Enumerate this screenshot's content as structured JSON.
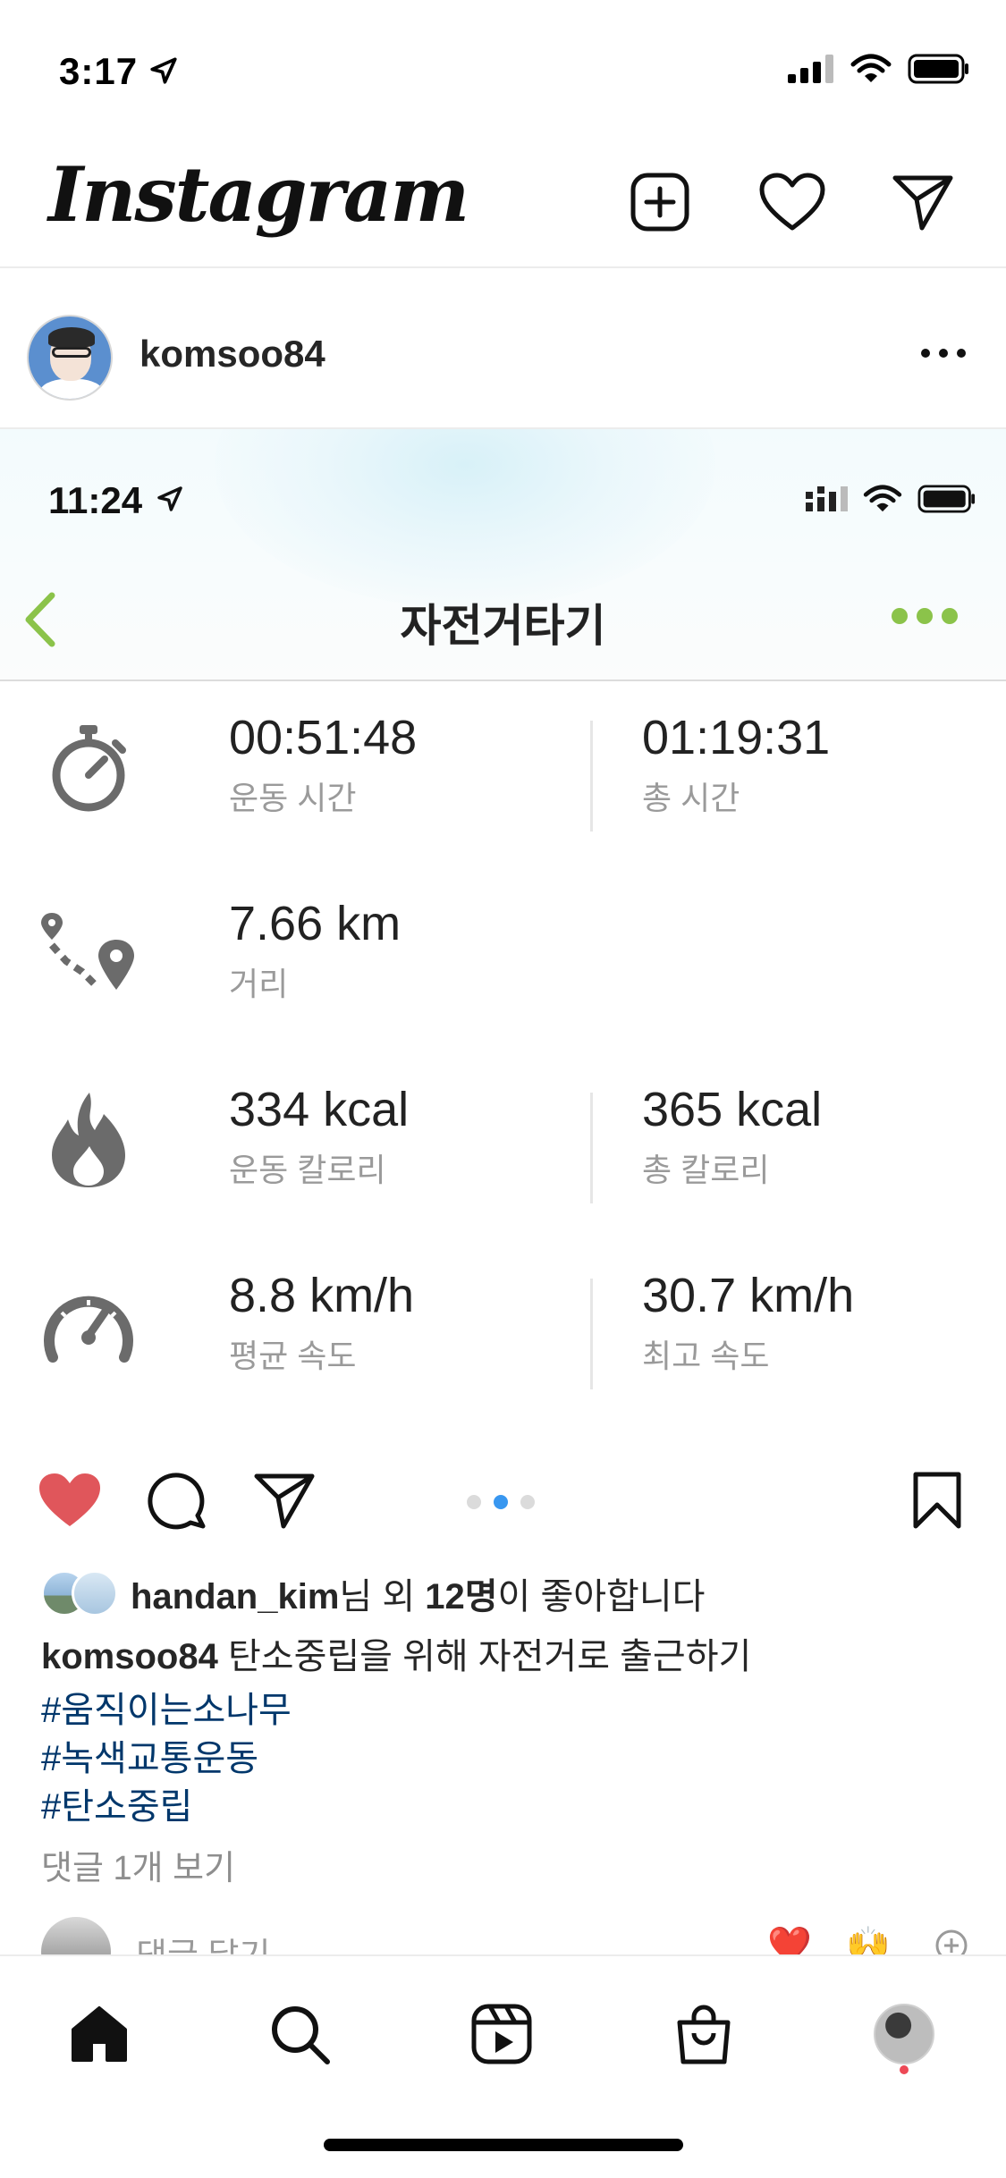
{
  "status_bar": {
    "time": "3:17"
  },
  "header": {
    "logo": "Instagram"
  },
  "post": {
    "username": "komsoo84",
    "embedded": {
      "time": "11:24",
      "title": "자전거타기",
      "metrics": {
        "exercise_time": {
          "value": "00:51:48",
          "label": "운동 시간"
        },
        "total_time": {
          "value": "01:19:31",
          "label": "총 시간"
        },
        "distance": {
          "value": "7.66 km",
          "label": "거리"
        },
        "exercise_calories": {
          "value": "334 kcal",
          "label": "운동 칼로리"
        },
        "total_calories": {
          "value": "365 kcal",
          "label": "총 칼로리"
        },
        "avg_speed": {
          "value": "8.8 km/h",
          "label": "평균 속도"
        },
        "max_speed": {
          "value": "30.7 km/h",
          "label": "최고 속도"
        }
      },
      "accent_color": "#8bc34a"
    },
    "carousel": {
      "count": 3,
      "active_index": 1
    },
    "likes": {
      "user": "handan_kim",
      "mid": "님 외 ",
      "count": "12명",
      "suffix": "이 좋아합니다"
    },
    "caption": {
      "username": "komsoo84",
      "text": " 탄소중립을 위해 자전거로 출근하기",
      "hashtags": [
        "#움직이는소나무",
        "#녹색교통운동",
        "#탄소중립"
      ]
    },
    "comments_link": "댓글 1개 보기",
    "comment_placeholder": "댓글 달기...",
    "quick_emojis": [
      "❤️",
      "🙌"
    ]
  },
  "tabs": [
    "home",
    "search",
    "reels",
    "shop",
    "profile"
  ],
  "colors": {
    "like_red": "#e0565b",
    "hashtag_blue": "#00376b",
    "carousel_active": "#3897f0"
  }
}
